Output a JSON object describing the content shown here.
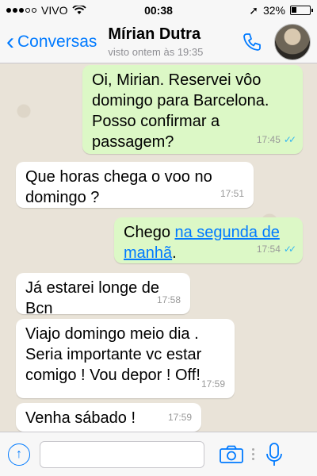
{
  "status_bar": {
    "carrier": "VIVO",
    "time": "00:38",
    "battery": "32%"
  },
  "header": {
    "back_label": "Conversas",
    "contact_name": "Mírian Dutra",
    "last_seen": "visto ontem às 19:35"
  },
  "messages": [
    {
      "direction": "out",
      "text": "Oi, Mirian. Reservei vôo domingo para Barcelona. Posso confirmar a passagem?",
      "time": "17:45",
      "read": true
    },
    {
      "direction": "in",
      "text": "Que horas chega o voo no domingo ?",
      "time": "17:51"
    },
    {
      "direction": "out",
      "text_before": "Chego ",
      "link": "na segunda de manhã",
      "text_after": ".",
      "time": "17:54",
      "read": true
    },
    {
      "direction": "in",
      "text": "Já estarei longe de  Bcn",
      "time": "17:58"
    },
    {
      "direction": "in",
      "text": "Viajo domingo meio dia . Seria importante vc estar comigo ! Vou depor ! Off!",
      "time": "17:59"
    },
    {
      "direction": "in",
      "text": "Venha sábado !",
      "time": "17:59"
    }
  ],
  "colors": {
    "accent": "#007aff",
    "outgoing_bubble": "#dcf8c6",
    "incoming_bubble": "#ffffff",
    "read_ticks": "#34b7f1"
  },
  "icons": {
    "back": "chevron-left-icon",
    "call": "phone-icon",
    "attach": "arrow-up-icon",
    "camera": "camera-icon",
    "mic": "microphone-icon"
  },
  "input": {
    "value": "",
    "placeholder": ""
  }
}
